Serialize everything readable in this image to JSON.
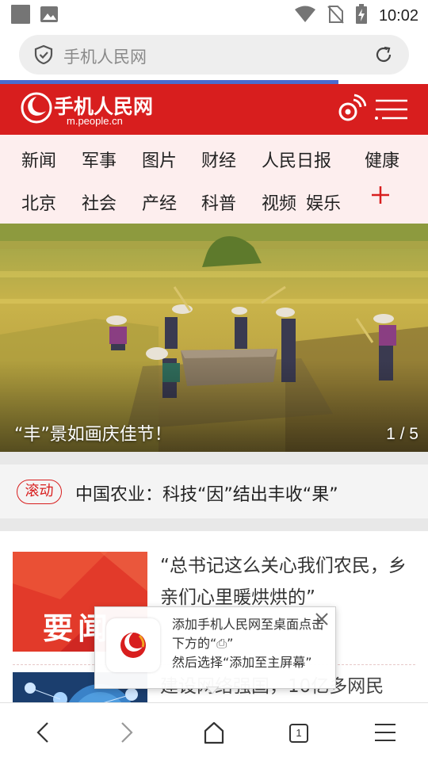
{
  "status_bar": {
    "time": "10:02"
  },
  "url_bar": {
    "text": "手机人民网"
  },
  "header": {
    "logo_text": "手机人民网",
    "logo_subtext": "m.people.cn"
  },
  "nav": {
    "items": [
      "新闻",
      "军事",
      "图片",
      "财经",
      "人民日报",
      "健康",
      "北京",
      "社会",
      "产经",
      "科普",
      "视频",
      "娱乐"
    ],
    "more_symbol": "+"
  },
  "hero": {
    "caption": "“丰”景如画庆佳节！",
    "counter": "1 / 5"
  },
  "ticker": {
    "badge": "滚动",
    "text": "中国农业：科技“因”结出丰收“果”"
  },
  "list": {
    "items": [
      {
        "thumb_text": "要闻",
        "title": "“总书记这么关心我们农民，乡亲们心里暖烘烘的”"
      },
      {
        "title": "建设网络强国，10亿多网民"
      }
    ]
  },
  "popup": {
    "line1": "添加手机人民网至桌面点击下方的“",
    "share_symbol": "⎙",
    "line1_end": "”",
    "line2": "然后选择“添加至主屏幕”"
  },
  "bottom_bar": {
    "tab_count": "1"
  },
  "colors": {
    "brand_red": "#d81e1e",
    "nav_bg": "#fdeeee",
    "progress_blue": "#4a6bd0"
  },
  "page_load_progress": 0.79
}
